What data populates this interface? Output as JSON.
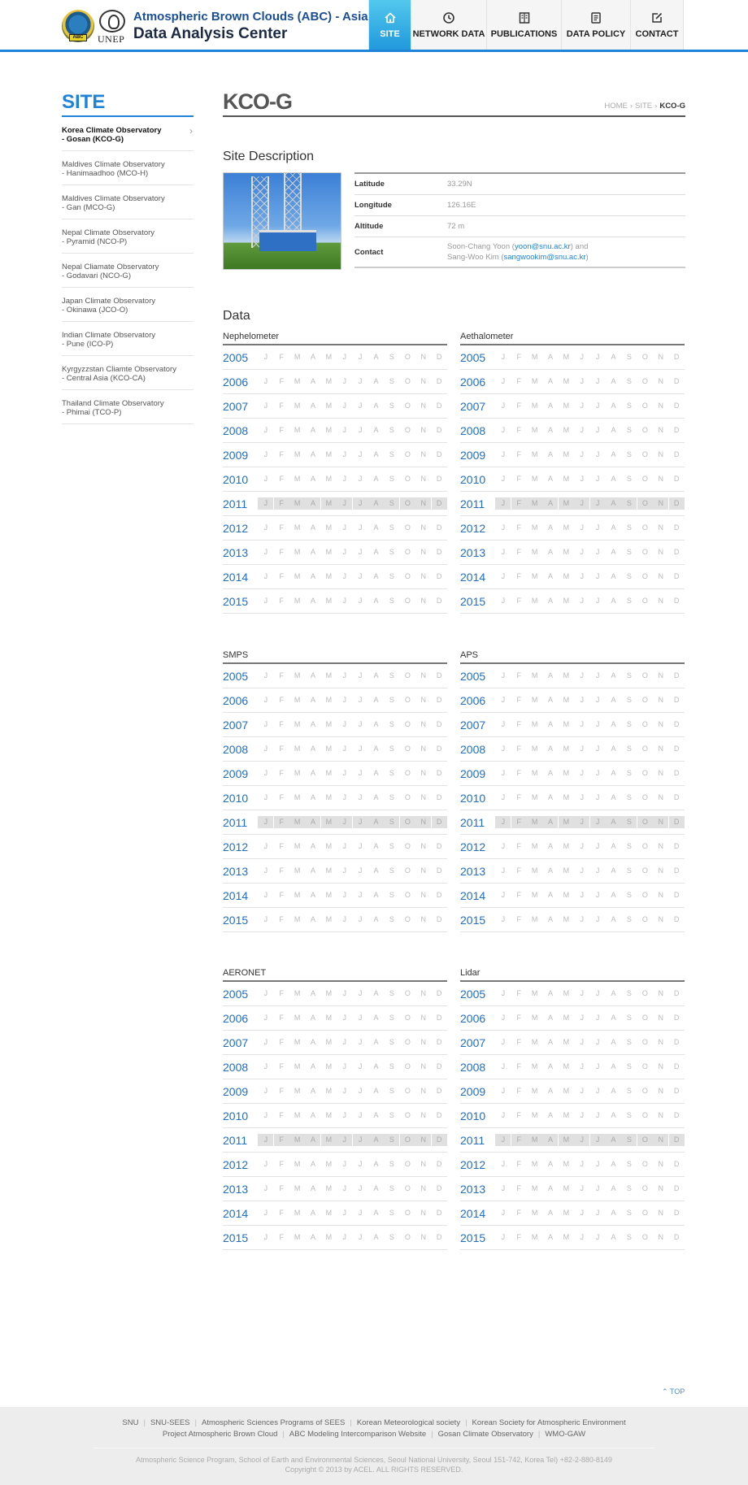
{
  "header": {
    "title_line1": "Atmospheric Brown Clouds (ABC) - Asia",
    "title_line2": "Data Analysis Center",
    "logo_abc_tag": "ABC",
    "logo_unep": "UNEP",
    "nav": [
      {
        "label": "SITE",
        "icon": "home-icon",
        "active": true
      },
      {
        "label": "NETWORK DATA",
        "icon": "clock-icon",
        "active": false
      },
      {
        "label": "PUBLICATIONS",
        "icon": "book-icon",
        "active": false
      },
      {
        "label": "DATA POLICY",
        "icon": "document-icon",
        "active": false
      },
      {
        "label": "CONTACT",
        "icon": "edit-icon",
        "active": false
      }
    ]
  },
  "sidebar": {
    "title": "SITE",
    "items": [
      {
        "line1": "Korea Climate Observatory",
        "line2": "- Gosan (KCO-G)",
        "active": true
      },
      {
        "line1": "Maldives Climate Observatory",
        "line2": "- Hanimaadhoo (MCO-H)"
      },
      {
        "line1": "Maldives Climate Observatory",
        "line2": "- Gan (MCO-G)"
      },
      {
        "line1": "Nepal Climate Observatory",
        "line2": "- Pyramid (NCO-P)"
      },
      {
        "line1": "Nepal Cliamate Observatory",
        "line2": "- Godavari (NCO-G)"
      },
      {
        "line1": "Japan Climate Observatory",
        "line2": "- Okinawa (JCO-O)"
      },
      {
        "line1": "Indian Climate Observatory",
        "line2": "- Pune (ICO-P)"
      },
      {
        "line1": "Kyrgyzzstan Cliamte Observatory",
        "line2": "- Central Asia (KCO-CA)"
      },
      {
        "line1": "Thailand Climate Observatory",
        "line2": "- Phimai (TCO-P)"
      }
    ]
  },
  "page": {
    "title": "KCO-G",
    "breadcrumb": [
      "HOME",
      "SITE",
      "KCO-G"
    ],
    "site_description_title": "Site Description",
    "info": {
      "latitude_label": "Latitude",
      "latitude": "33.29N",
      "longitude_label": "Longitude",
      "longitude": "126.16E",
      "altitude_label": "Altitude",
      "altitude": "72 m",
      "contact_label": "Contact",
      "contact_name1": "Soon-Chang Yoon (",
      "contact_email1": "yoon@snu.ac.kr",
      "contact_mid": ") and",
      "contact_name2": "Sang-Woo Kim (",
      "contact_email2": "sangwookim@snu.ac.kr",
      "contact_end": ")"
    },
    "data_title": "Data"
  },
  "months": [
    "J",
    "F",
    "M",
    "A",
    "M",
    "J",
    "J",
    "A",
    "S",
    "O",
    "N",
    "D"
  ],
  "years": [
    "2005",
    "2006",
    "2007",
    "2008",
    "2009",
    "2010",
    "2011",
    "2012",
    "2013",
    "2014",
    "2015"
  ],
  "shaded_year": "2011",
  "instruments": [
    "Nephelometer",
    "Aethalometer",
    "SMPS",
    "APS",
    "AERONET",
    "Lidar"
  ],
  "footer": {
    "top_label": "TOP",
    "links_line1": [
      "SNU",
      "SNU-SEES",
      "Atmospheric Sciences Programs of SEES",
      "Korean Meteorological society",
      "Korean Society for Atmospheric Environment"
    ],
    "links_line2": [
      "Project Atmospheric Brown Cloud",
      "ABC Modeling Intercomparison Website",
      "Gosan Climate Observatory",
      "WMO-GAW"
    ],
    "address": "Atmospheric Science Program, School of Earth and Environmental Sciences, Seoul National University, Seoul 151-742, Korea      Tel) +82-2-880-8149",
    "copyright": "Copyright © 2013 by ACEL. ALL RIGHTS RESERVED."
  }
}
